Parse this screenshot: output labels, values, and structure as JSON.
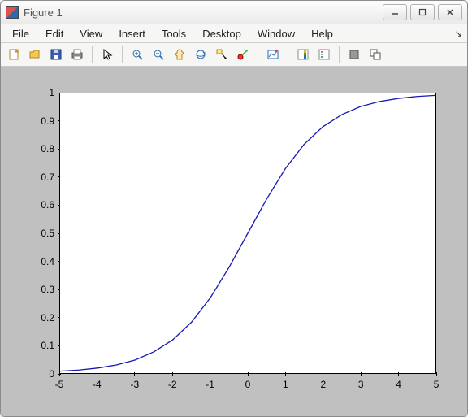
{
  "window": {
    "title": "Figure 1"
  },
  "menu": {
    "items": [
      "File",
      "Edit",
      "View",
      "Insert",
      "Tools",
      "Desktop",
      "Window",
      "Help"
    ]
  },
  "toolbar": {
    "icons": [
      "new-figure-icon",
      "open-icon",
      "save-icon",
      "print-icon",
      "sep",
      "pointer-icon",
      "sep",
      "zoom-in-icon",
      "zoom-out-icon",
      "pan-icon",
      "rotate3d-icon",
      "data-cursor-icon",
      "brush-icon",
      "sep",
      "link-plot-icon",
      "sep",
      "colorbar-icon",
      "legend-icon",
      "sep",
      "hide-plot-tools-icon",
      "show-plot-tools-icon"
    ]
  },
  "chart_data": {
    "type": "line",
    "title": "",
    "xlabel": "",
    "ylabel": "",
    "xlim": [
      -5,
      5
    ],
    "ylim": [
      0,
      1
    ],
    "xticks": [
      -5,
      -4,
      -3,
      -2,
      -1,
      0,
      1,
      2,
      3,
      4,
      5
    ],
    "yticks": [
      0,
      0.1,
      0.2,
      0.3,
      0.4,
      0.5,
      0.6,
      0.7,
      0.8,
      0.9,
      1
    ],
    "series": [
      {
        "name": "",
        "color": "#1818b4",
        "x": [
          -5,
          -4.5,
          -4,
          -3.5,
          -3,
          -2.5,
          -2,
          -1.5,
          -1,
          -0.5,
          0,
          0.5,
          1,
          1.5,
          2,
          2.5,
          3,
          3.5,
          4,
          4.5,
          5
        ],
        "y": [
          0.007,
          0.011,
          0.018,
          0.029,
          0.047,
          0.076,
          0.119,
          0.182,
          0.269,
          0.378,
          0.5,
          0.622,
          0.731,
          0.818,
          0.881,
          0.924,
          0.953,
          0.971,
          0.982,
          0.989,
          0.993
        ]
      }
    ]
  }
}
